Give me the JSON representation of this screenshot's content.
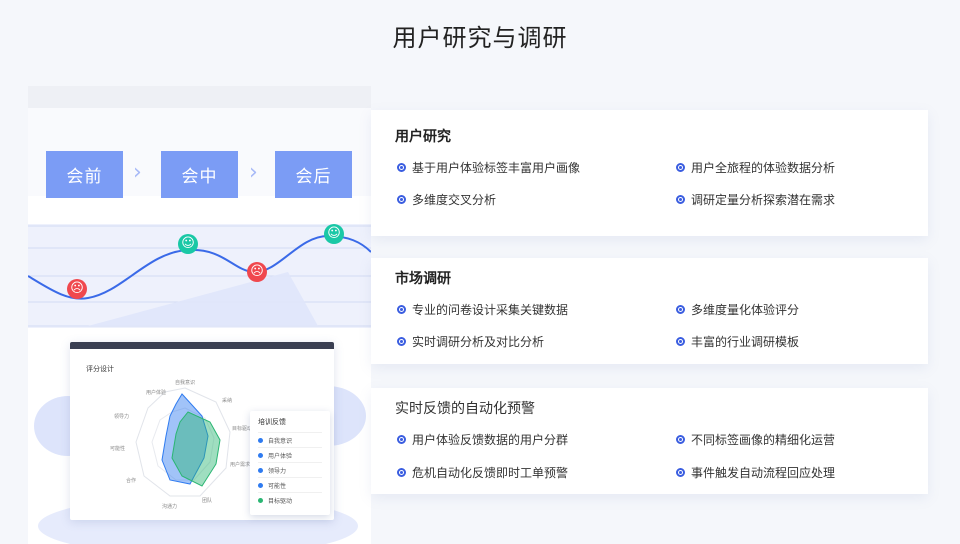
{
  "page": {
    "title": "用户研究与调研"
  },
  "illustration": {
    "stages": [
      "会前",
      "会中",
      "会后"
    ],
    "arrow_glyph": "›",
    "faces": {
      "sad": "☹",
      "happy": "☺"
    },
    "dashboard": {
      "title": "评分设计",
      "radar_labels": [
        "自我意识",
        "采纳",
        "目标驱动",
        "用户需求",
        "团队",
        "沟通力",
        "合作",
        "可能性",
        "领导力",
        "用户体验"
      ],
      "legend_title": "培训反馈",
      "legend_items": [
        {
          "label": "自我意识",
          "color": "#2f7bf0"
        },
        {
          "label": "用户体验",
          "color": "#2f7bf0"
        },
        {
          "label": "领导力",
          "color": "#2f7bf0"
        },
        {
          "label": "可能性",
          "color": "#2f7bf0"
        },
        {
          "label": "目标驱动",
          "color": "#2bb673"
        }
      ]
    }
  },
  "panels": [
    {
      "title": "用户研究",
      "items": [
        "基于用户体验标签丰富用户画像",
        "用户全旅程的体验数据分析",
        "多维度交叉分析",
        "调研定量分析探索潜在需求"
      ]
    },
    {
      "title": "市场调研",
      "items": [
        "专业的问卷设计采集关键数据",
        "多维度量化体验评分",
        "实时调研分析及对比分析",
        "丰富的行业调研模板"
      ]
    },
    {
      "title": "实时反馈的自动化预警",
      "items": [
        "用户体验反馈数据的用户分群",
        "不同标签画像的精细化运营",
        "危机自动化反馈即时工单预警",
        "事件触发自动流程回应处理"
      ]
    }
  ],
  "colors": {
    "accent": "#3a5de0",
    "stage": "#7b9cf5",
    "sad": "#f0484e",
    "happy": "#19c8a6"
  }
}
